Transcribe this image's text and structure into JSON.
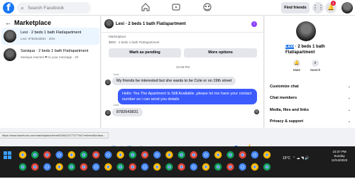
{
  "topbar": {
    "logo": "f",
    "search_placeholder": "Search Facebook",
    "find_friends_label": "Find friends",
    "notification_count": "1"
  },
  "sidebar": {
    "title": "Marketplace",
    "conversations": [
      {
        "name": "Lexi · 2 beds 1 bath Flat/apartment",
        "sub": "Lexi: 8782643831 · 20m"
      },
      {
        "name": "Saniqua · 2 beds 1 bath Flat/apartment",
        "sub": "Saniqua reacted ❤ to your message · 2h"
      }
    ]
  },
  "chat": {
    "title": "Lexi · 2 beds 1 bath Flat/apartment",
    "listing_caption": "Marketplace",
    "listing_sub": "$900 · 2 beds 1 bath Flat/apartment",
    "mark_pending_label": "Mark as pending",
    "more_options_label": "More options",
    "timestamp": "10:08 PM",
    "sender_1": "Lexi",
    "msg_in_1": "My friends be interested but she wants to be Cole or on 19th street",
    "msg_out_1": "Hello: Yes The Apartment Is Still Available ,please let me have your contact number so i can send you details",
    "sender_2": "Lexi",
    "msg_in_2": "8782643831",
    "composer_placeholder": "Aa"
  },
  "right_panel": {
    "name_highlight": "Lexi",
    "name_rest": " · 2 beds 1 bath Flat/apartment",
    "mute_label": "Mute",
    "search_label": "Search",
    "rows": [
      "Customize chat",
      "Chat members",
      "Media, files and links",
      "Privacy & support"
    ]
  },
  "status_url": "https://www.facebook.com/marketplace/item/834042217727744/?referralSurface...",
  "taskbar": {
    "weather": "15°C",
    "time": "10:37 PM",
    "day": "Sunday",
    "date": "12/14/2023"
  },
  "colors": {
    "brand": "#1877f2",
    "outgoing_bubble": "#3b5bfd",
    "active_item": "#ebf5ff"
  }
}
